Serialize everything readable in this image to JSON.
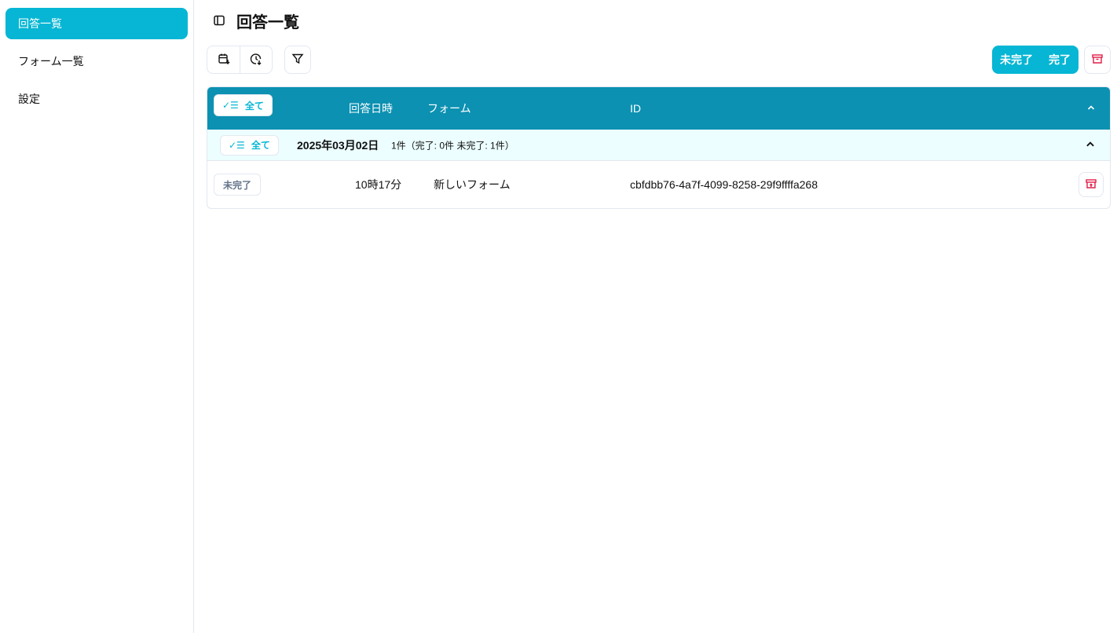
{
  "sidebar": {
    "items": [
      {
        "label": "回答一覧",
        "active": true
      },
      {
        "label": "フォーム一覧"
      },
      {
        "label": "設定"
      }
    ]
  },
  "header": {
    "title": "回答一覧"
  },
  "toolbar": {
    "status_segments": [
      "未完了",
      "完了"
    ]
  },
  "table": {
    "select_all_label": "全て",
    "columns": [
      "回答日時",
      "フォーム",
      "ID"
    ],
    "groups": [
      {
        "date": "2025年03月02日",
        "summary": "1件（完了: 0件 未完了: 1件）",
        "select_all_label": "全て",
        "rows": [
          {
            "status": "未完了",
            "time": "10時17分",
            "form": "新しいフォーム",
            "id": "cbfdbb76-4a7f-4099-8258-29f9ffffa268"
          }
        ]
      }
    ]
  },
  "colors": {
    "accent": "#06b6d4",
    "header": "#0c91b2",
    "danger": "#e11d48"
  }
}
